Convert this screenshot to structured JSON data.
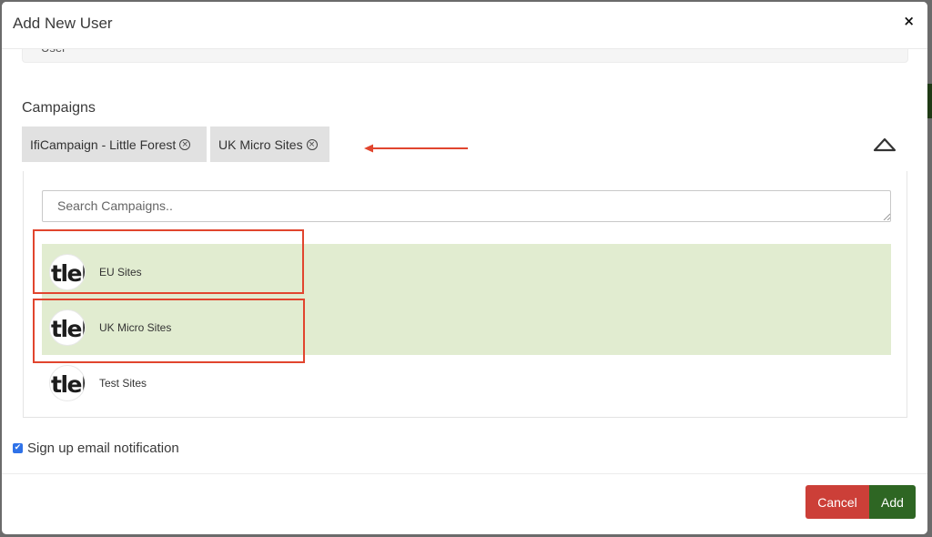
{
  "modal": {
    "title": "Add New User",
    "close_label": "×"
  },
  "role_select": {
    "value": "User"
  },
  "campaigns": {
    "label": "Campaigns",
    "selected_tags": [
      {
        "label": "IfiCampaign - Little Forest",
        "remove_icon": "⊗"
      },
      {
        "label": "UK Micro Sites",
        "remove_icon": "⊗"
      }
    ],
    "search_placeholder": "Search Campaigns..",
    "options": [
      {
        "logo_text": "tleF",
        "name": "EU Sites",
        "selected": true
      },
      {
        "logo_text": "tleF",
        "name": "UK Micro Sites",
        "selected": true
      },
      {
        "logo_text": "tleF",
        "name": "Test Sites",
        "selected": false
      }
    ]
  },
  "notification": {
    "label": "Sign up email notification",
    "checked": true,
    "check_glyph": "✔"
  },
  "footer": {
    "cancel_label": "Cancel",
    "add_label": "Add"
  },
  "colors": {
    "selected_option_bg": "#e1ecd0",
    "annotation_red": "#e1452e",
    "cancel_red": "#cc3f38",
    "add_green": "#2e6623",
    "checkbox_blue": "#2f72e8"
  }
}
